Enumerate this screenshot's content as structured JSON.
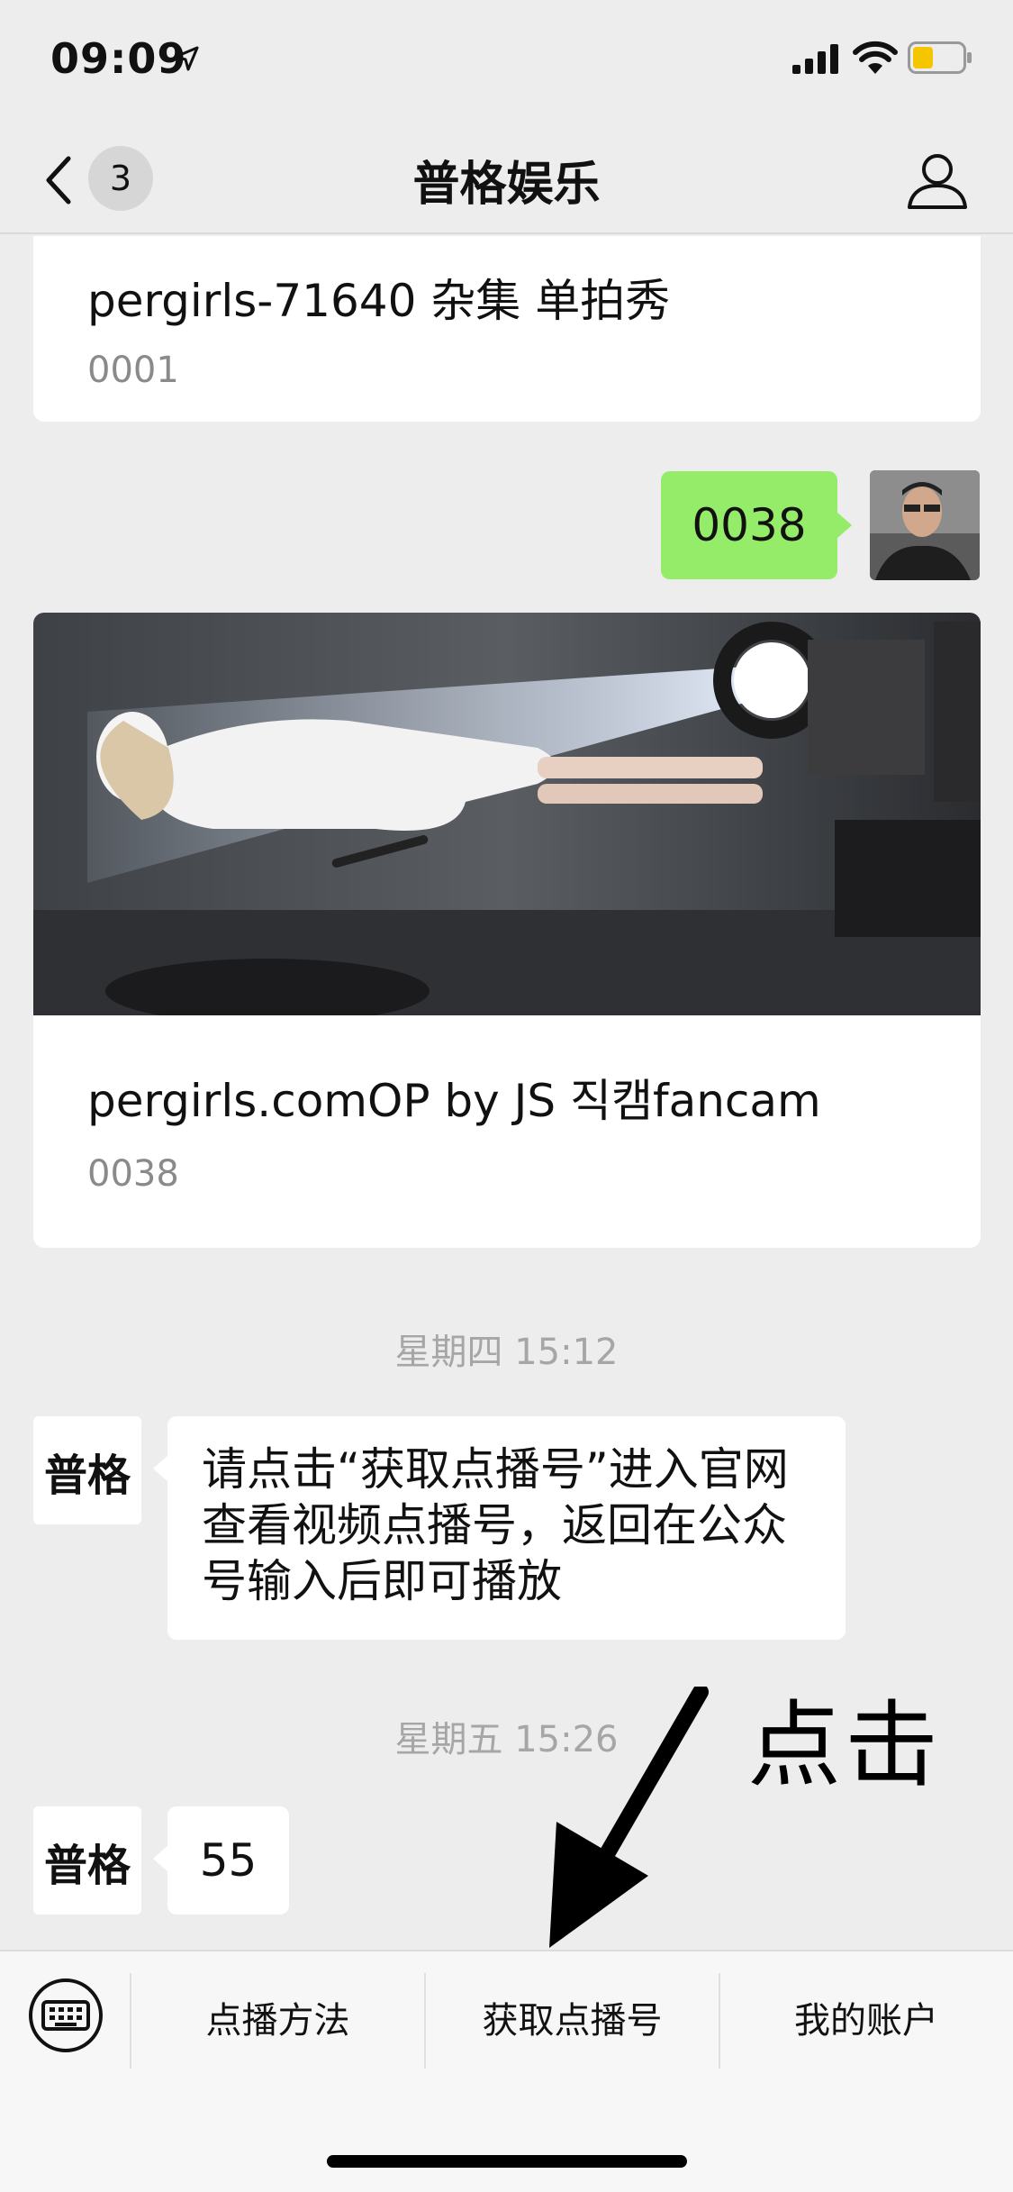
{
  "status_bar": {
    "time": "09:09"
  },
  "nav": {
    "title": "普格娱乐",
    "back_badge": "3"
  },
  "messages": {
    "card1": {
      "title": "pergirls-71640 杂集 单拍秀",
      "code": "0001"
    },
    "user_message": "0038",
    "card2": {
      "title": "pergirls.comOP by JS 직캠fancam",
      "code": "0038"
    },
    "timestamp1": "星期四 15:12",
    "bot_message1": "请点击“获取点播号”进入官网查看视频点播号，返回在公众号输入后即可播放",
    "timestamp2": "星期五 15:26",
    "bot_message2": "55"
  },
  "bot_avatar_text": "普格",
  "annotation": {
    "text": "点击"
  },
  "bottom_menu": {
    "items": [
      "点播方法",
      "获取点播号",
      "我的账户"
    ]
  },
  "colors": {
    "user_bubble": "#95ec69",
    "background": "#ededed"
  }
}
